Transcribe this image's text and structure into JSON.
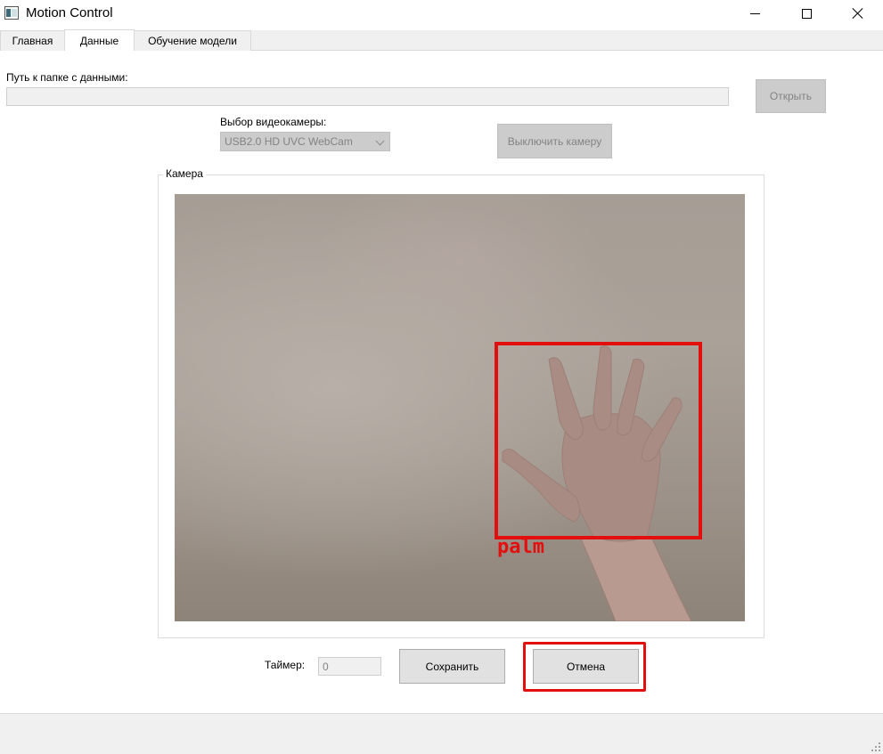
{
  "window": {
    "title": "Motion Control"
  },
  "tabs": [
    {
      "label": "Главная",
      "active": false
    },
    {
      "label": "Данные",
      "active": true
    },
    {
      "label": "Обучение модели",
      "active": false
    }
  ],
  "data_tab": {
    "path_label": "Путь к папке с данными:",
    "path_value": "",
    "open_button": "Открыть",
    "camera_select_label": "Выбор видеокамеры:",
    "camera_select_value": "USB2.0 HD UVC WebCam",
    "camera_toggle_button": "Выключить камеру",
    "camera_group_title": "Камера",
    "detection_label": "palm",
    "timer_label": "Таймер:",
    "timer_value": "0",
    "save_button": "Сохранить",
    "cancel_button": "Отмена"
  },
  "colors": {
    "detection": "#e30f0f",
    "highlight": "#e30f0f"
  }
}
